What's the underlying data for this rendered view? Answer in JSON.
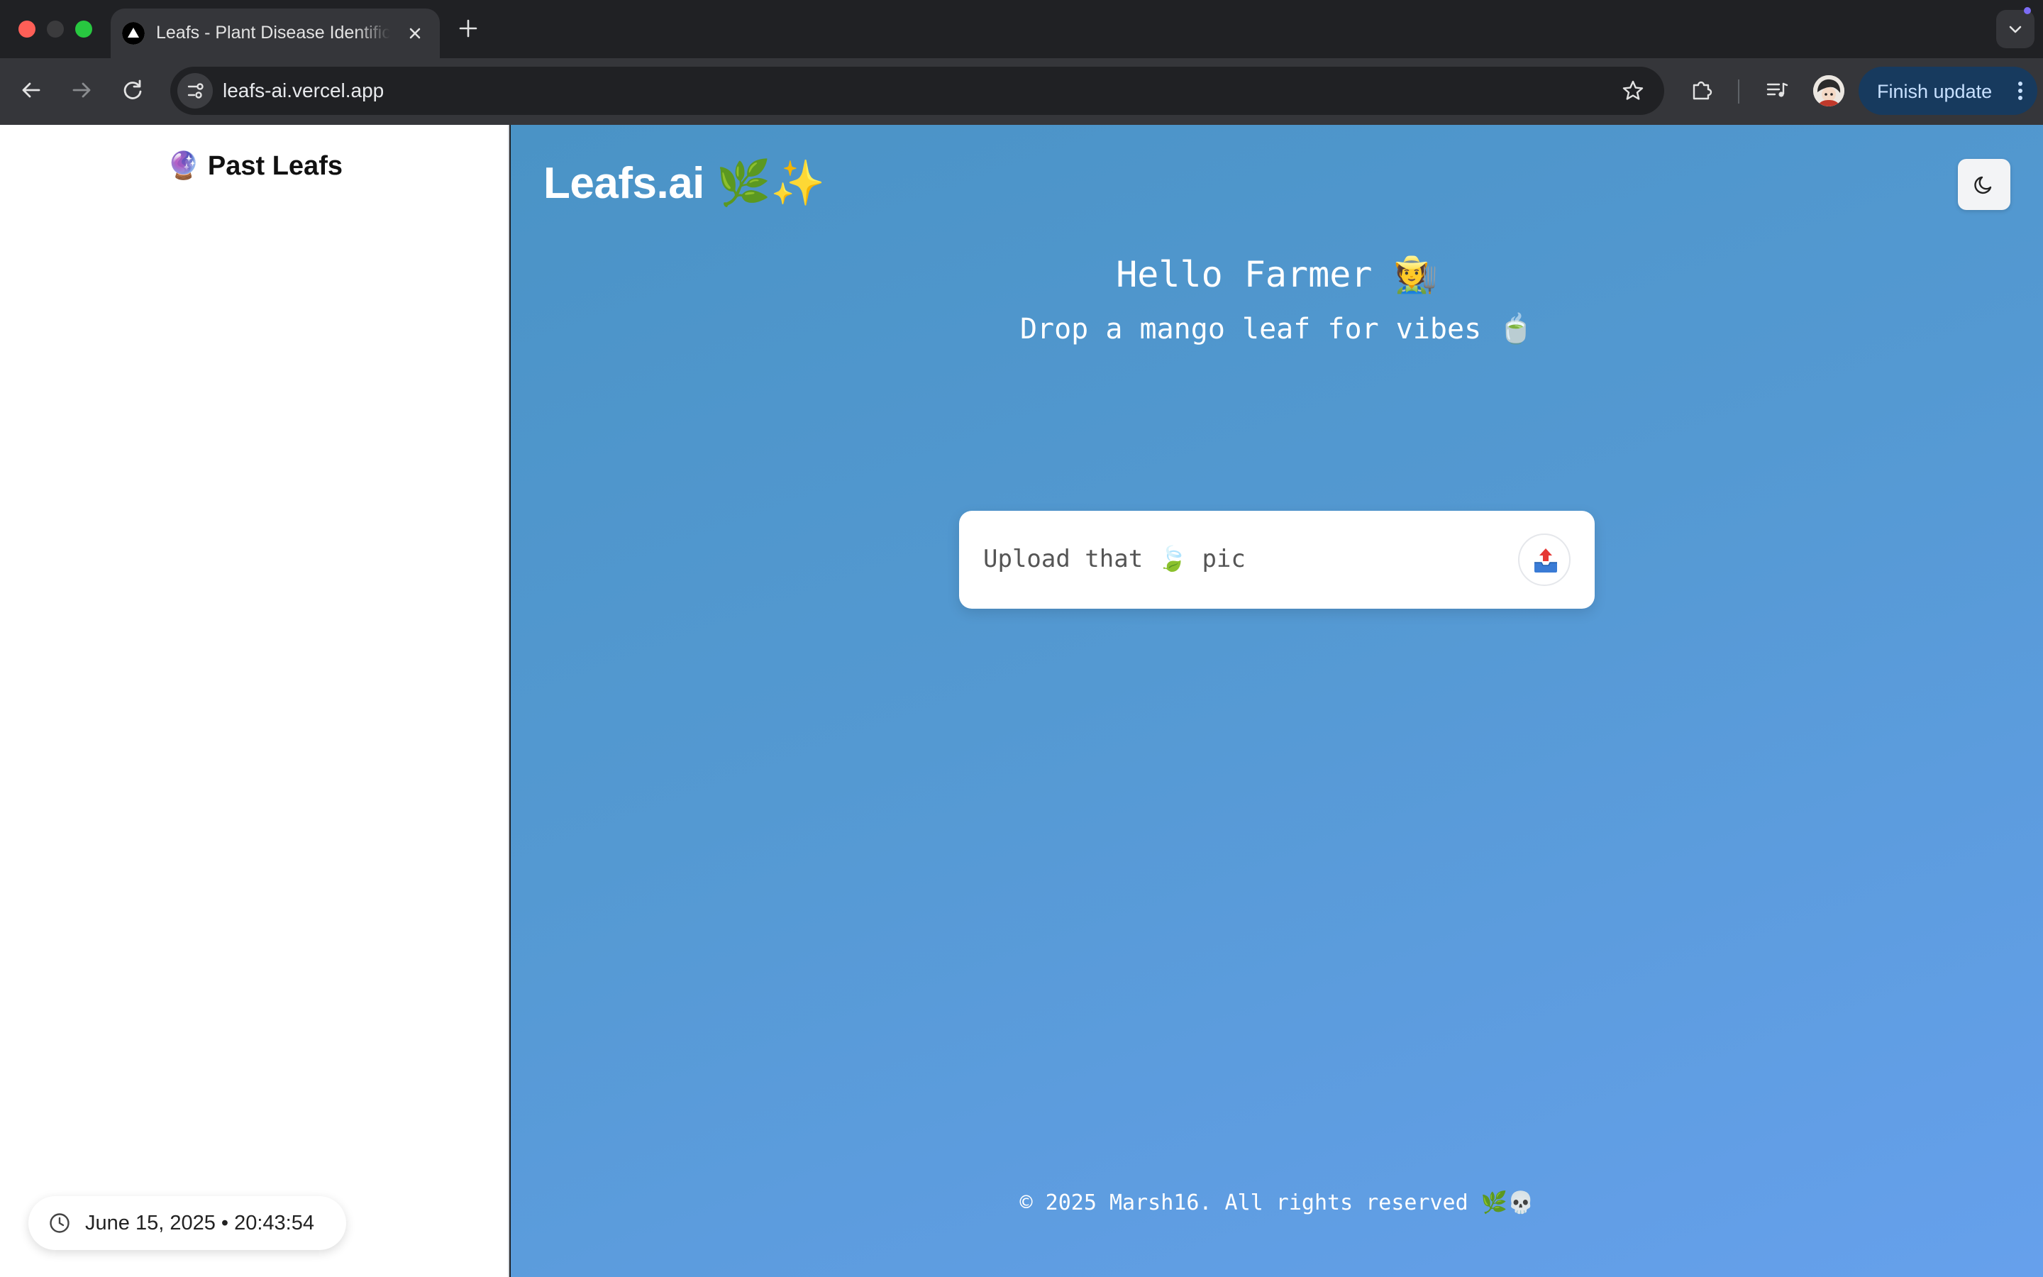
{
  "browser": {
    "tab_title": "Leafs - Plant Disease Identification",
    "url": "leafs-ai.vercel.app",
    "update_button_label": "Finish update"
  },
  "sidebar": {
    "title": "🔮 Past Leafs",
    "clock_text": "June 15, 2025 • 20:43:54"
  },
  "main": {
    "brand": "Leafs.ai 🌿✨",
    "greeting": "Hello Farmer 🧑‍🌾",
    "subtitle": "Drop a mango leaf for vibes 🍵",
    "upload_placeholder": "Upload that 🍃 pic",
    "footer": "© 2025 Marsh16. All rights reserved 🌿💀"
  },
  "icons": {
    "tab_favicon": "vercel-triangle-icon",
    "upload_button": "upload-tray-icon",
    "theme_toggle": "moon-icon",
    "clock": "clock-icon"
  },
  "colors": {
    "main_gradient_start": "#4a93c6",
    "main_gradient_end": "#66a0ec",
    "sidebar_bg": "#ffffff",
    "update_button_bg": "#173a5e"
  }
}
